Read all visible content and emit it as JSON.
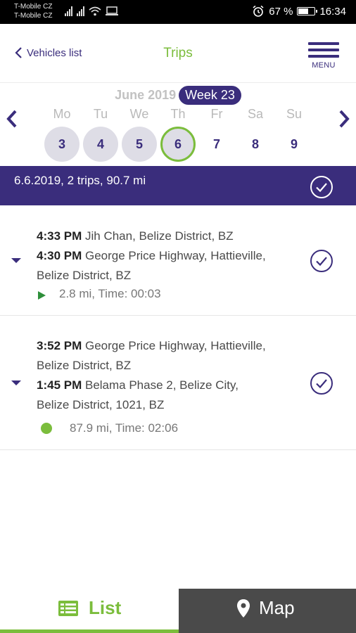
{
  "status_bar": {
    "carrier_1": "T-Mobile CZ",
    "carrier_2": "T-Mobile CZ",
    "battery_percent": "67 %",
    "battery_level": 0.67,
    "time": "16:34"
  },
  "header": {
    "back_label": "Vehicles list",
    "title": "Trips",
    "menu_label": "MENU"
  },
  "calendar": {
    "month": "June 2019",
    "week": "Week 23",
    "days": [
      {
        "name": "Mo",
        "num": "3",
        "state": "past"
      },
      {
        "name": "Tu",
        "num": "4",
        "state": "past"
      },
      {
        "name": "We",
        "num": "5",
        "state": "past"
      },
      {
        "name": "Th",
        "num": "6",
        "state": "selected"
      },
      {
        "name": "Fr",
        "num": "7",
        "state": "future"
      },
      {
        "name": "Sa",
        "num": "8",
        "state": "future"
      },
      {
        "name": "Su",
        "num": "9",
        "state": "future"
      }
    ]
  },
  "summary": {
    "text": "6.6.2019, 2 trips, 90.7 mi"
  },
  "trips": [
    {
      "end_time": "4:33 PM",
      "end_place": "Jih Chan, Belize District, BZ",
      "start_time": "4:30 PM",
      "start_place_line1": "George Price Highway, Hattieville,",
      "start_place_line2": "Belize District, BZ",
      "meta": "2.8 mi, Time: 00:03"
    },
    {
      "end_time": "3:52 PM",
      "end_place_line1": "George Price Highway, Hattieville,",
      "end_place_line2": "Belize District, BZ",
      "start_time": "1:45 PM",
      "start_place_line1": "Belama Phase 2, Belize City,",
      "start_place_line2": "Belize District, 1021, BZ",
      "meta": "87.9 mi, Time: 02:06"
    }
  ],
  "bottom_tabs": {
    "list_label": "List",
    "map_label": "Map"
  },
  "colors": {
    "primary": "#3a2d7c",
    "accent": "#7bbd3c",
    "map_tab": "#4a4a4a"
  }
}
